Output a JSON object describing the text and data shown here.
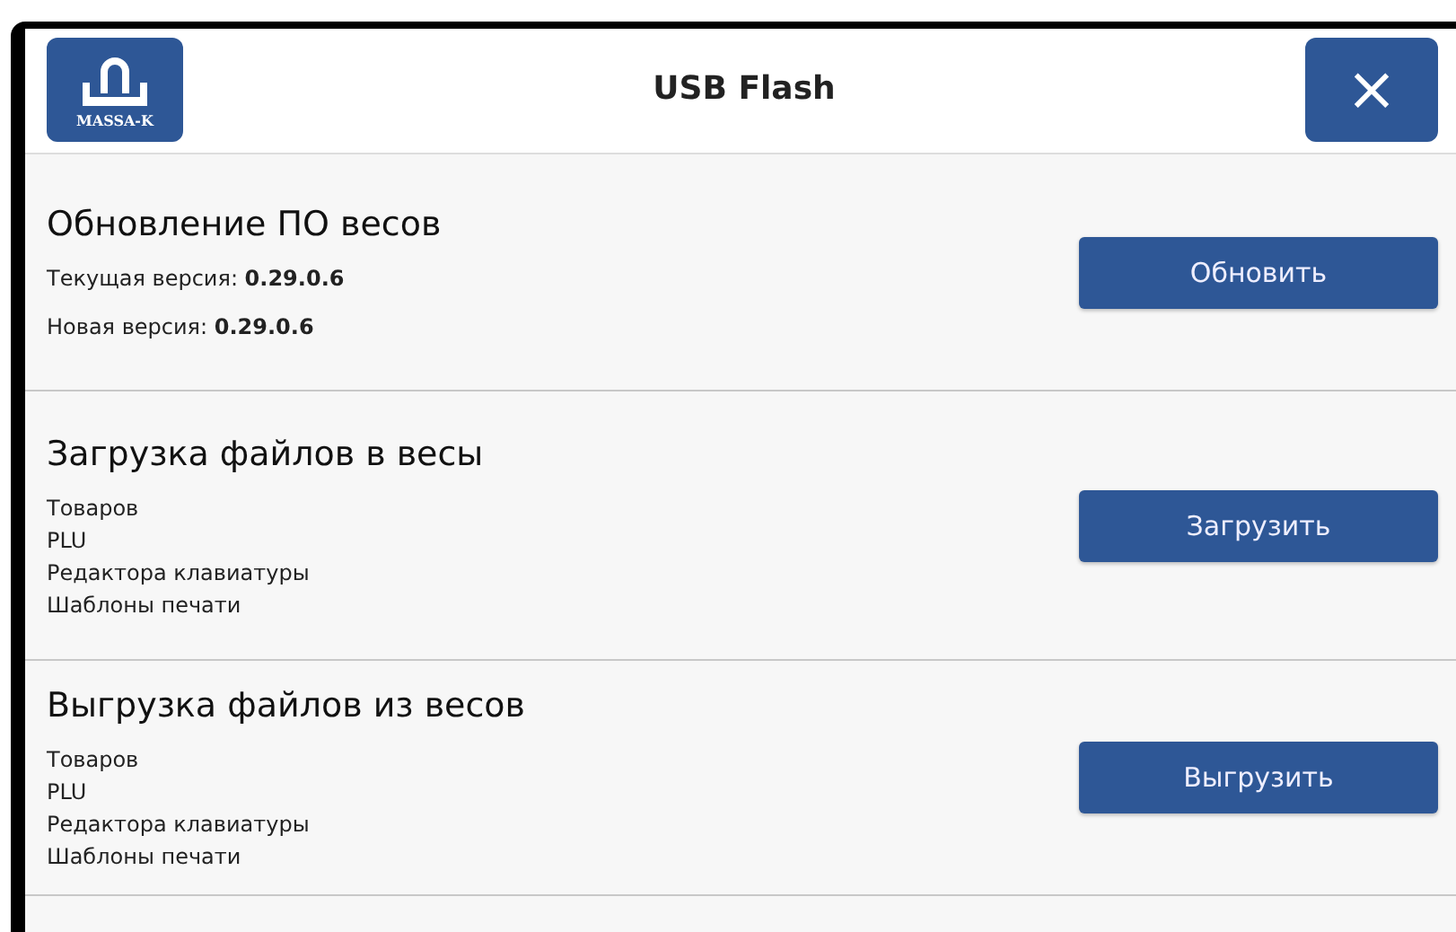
{
  "header": {
    "logo_text": "MASSA-K",
    "title": "USB Flash",
    "close": "×"
  },
  "sections": [
    {
      "title": "Обновление ПО весов",
      "kind": "versions",
      "lines": [
        "Текущая версия: **0.29.0.6**",
        "Новая версия: **0.29.0.6**"
      ],
      "button": "Обновить"
    },
    {
      "title": "Загрузка файлов в весы",
      "kind": "list",
      "lines": [
        "Товаров",
        "PLU",
        "Редактора клавиатуры",
        "Шаблоны печати"
      ],
      "button": "Загрузить"
    },
    {
      "title": "Выгрузка файлов из весов",
      "kind": "list",
      "lines": [
        "Товаров",
        "PLU",
        "Редактора клавиатуры",
        "Шаблоны печати"
      ],
      "button": "Выгрузить"
    }
  ]
}
